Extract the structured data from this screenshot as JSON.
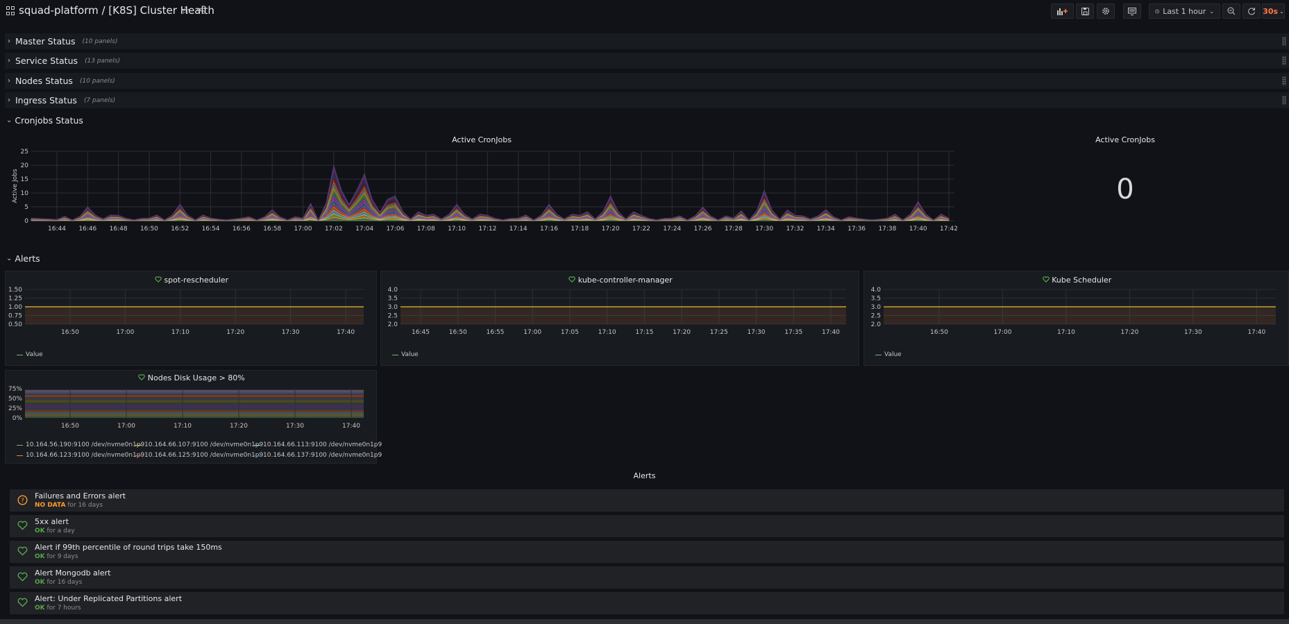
{
  "header": {
    "title": "squad-platform / [K8S] Cluster Health",
    "time_range": "Last 1 hour",
    "refresh_interval": "30s"
  },
  "rows": [
    {
      "title": "Master Status",
      "count": "(10 panels)"
    },
    {
      "title": "Service Status",
      "count": "(13 panels)"
    },
    {
      "title": "Nodes Status",
      "count": "(10 panels)"
    },
    {
      "title": "Ingress Status",
      "count": "(7 panels)"
    }
  ],
  "sections": {
    "cronjobs": "Cronjobs Status",
    "alerts": "Alerts"
  },
  "cronjobs_graph": {
    "title": "Active CronJobs",
    "ylabel": "Active Jobs"
  },
  "cronjobs_stat": {
    "title": "Active CronJobs",
    "value": "0"
  },
  "panels": {
    "spot": {
      "title": "spot-rescheduler",
      "legend": "Value"
    },
    "kcm": {
      "title": "kube-controller-manager",
      "legend": "Value"
    },
    "ksched": {
      "title": "Kube Scheduler",
      "legend": "Value"
    },
    "disk": {
      "title": "Nodes Disk Usage > 80%",
      "legend": [
        "10.164.56.190:9100 /dev/nvme0n1p9",
        "10.164.66.107:9100 /dev/nvme0n1p9",
        "10.164.66.113:9100 /dev/nvme0n1p9",
        "10.164.66.123:9100 /dev/nvme0n1p9",
        "10.164.66.125:9100 /dev/nvme0n1p9",
        "10.164.66.137:9100 /dev/nvme0n1p9"
      ],
      "legend_colors": [
        "#7eb26d",
        "#eab839",
        "#6ed0e0",
        "#ef843c",
        "#e24d42",
        "#1f78c1"
      ]
    }
  },
  "alert_list": {
    "title": "Alerts",
    "items": [
      {
        "name": "Failures and Errors alert",
        "state": "NO DATA",
        "duration": "for 16 days"
      },
      {
        "name": "5xx alert",
        "state": "OK",
        "duration": "for a day"
      },
      {
        "name": "Alert if 99th percentile of round trips take 150ms",
        "state": "OK",
        "duration": "for 9 days"
      },
      {
        "name": "Alert Mongodb alert",
        "state": "OK",
        "duration": "for 16 days"
      },
      {
        "name": "Alert: Under Replicated Partitions alert",
        "state": "OK",
        "duration": "for 7 hours"
      }
    ]
  },
  "chart_data": [
    {
      "type": "area",
      "title": "Active CronJobs",
      "ylabel": "Active Jobs",
      "ylim": [
        0,
        25
      ],
      "yticks": [
        0,
        5,
        10,
        15,
        20,
        25
      ],
      "x": [
        "16:44",
        "16:46",
        "16:48",
        "16:50",
        "16:52",
        "16:54",
        "16:56",
        "16:58",
        "17:00",
        "17:02",
        "17:04",
        "17:06",
        "17:08",
        "17:10",
        "17:12",
        "17:14",
        "17:16",
        "17:18",
        "17:20",
        "17:22",
        "17:24",
        "17:26",
        "17:28",
        "17:30",
        "17:32",
        "17:34",
        "17:36",
        "17:38",
        "17:40",
        "17:42"
      ],
      "total": [
        0.5,
        5,
        2,
        1,
        6,
        1,
        1,
        4,
        1,
        20,
        17,
        9,
        2,
        6,
        2,
        1,
        6,
        2,
        9,
        2,
        1,
        5,
        1,
        11,
        2,
        4,
        1,
        1,
        7,
        1
      ],
      "series_colors": [
        "#7eb26d",
        "#eab839",
        "#6ed0e0",
        "#ef843c",
        "#e24d42",
        "#1f78c1",
        "#ba43a9",
        "#705da0",
        "#508642",
        "#cca300",
        "#447ebc",
        "#c15c17",
        "#890f02",
        "#0a437c",
        "#6d1f62",
        "#584477"
      ]
    },
    {
      "type": "line",
      "title": "spot-rescheduler",
      "ylim": [
        0.5,
        1.5
      ],
      "yticks": [
        "0.50",
        "0.75",
        "1.00",
        "1.25",
        "1.50"
      ],
      "xticks": [
        "16:50",
        "17:00",
        "17:10",
        "17:20",
        "17:30",
        "17:40"
      ],
      "series": [
        {
          "name": "Value",
          "value": 1
        }
      ]
    },
    {
      "type": "line",
      "title": "kube-controller-manager",
      "ylim": [
        2,
        4
      ],
      "yticks": [
        "2.0",
        "2.5",
        "3.0",
        "3.5",
        "4.0"
      ],
      "xticks": [
        "16:45",
        "16:50",
        "16:55",
        "17:00",
        "17:05",
        "17:10",
        "17:15",
        "17:20",
        "17:25",
        "17:30",
        "17:35",
        "17:40"
      ],
      "series": [
        {
          "name": "Value",
          "value": 3
        }
      ]
    },
    {
      "type": "line",
      "title": "Kube Scheduler",
      "ylim": [
        2,
        4
      ],
      "yticks": [
        "2.0",
        "2.5",
        "3.0",
        "3.5",
        "4.0"
      ],
      "xticks": [
        "16:50",
        "17:00",
        "17:10",
        "17:20",
        "17:30",
        "17:40"
      ],
      "series": [
        {
          "name": "Value",
          "value": 3
        }
      ]
    },
    {
      "type": "area",
      "title": "Nodes Disk Usage > 80%",
      "ylim": [
        0,
        75
      ],
      "yticks": [
        "0%",
        "25%",
        "50%",
        "75%"
      ],
      "xticks": [
        "16:50",
        "17:00",
        "17:10",
        "17:20",
        "17:30",
        "17:40"
      ]
    }
  ]
}
